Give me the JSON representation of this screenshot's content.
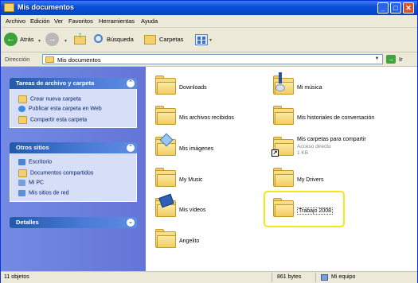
{
  "window": {
    "title": "Mis documentos"
  },
  "menu": [
    "Archivo",
    "Edición",
    "Ver",
    "Favoritos",
    "Herramientas",
    "Ayuda"
  ],
  "toolbar": {
    "back_label": "Atrás",
    "search_label": "Búsqueda",
    "folders_label": "Carpetas"
  },
  "address": {
    "label": "Dirección",
    "value": "Mis documentos",
    "go_label": "Ir"
  },
  "tasks": {
    "title": "Tareas de archivo y carpeta",
    "items": [
      "Crear nueva carpeta",
      "Publicar esta carpeta en Web",
      "Compartir esta carpeta"
    ]
  },
  "other_places": {
    "title": "Otros sitios",
    "items": [
      "Escritorio",
      "Documentos compartidos",
      "Mi PC",
      "Mis sitios de red"
    ]
  },
  "details": {
    "title": "Detalles"
  },
  "files": [
    {
      "name": "Downloads",
      "icon": "folder-icon"
    },
    {
      "name": "Mi música",
      "icon": "music-folder-icon"
    },
    {
      "name": "Mis archivos recibidos",
      "icon": "folder-icon"
    },
    {
      "name": "Mis historiales de conversación",
      "icon": "folder-icon"
    },
    {
      "name": "Mis imágenes",
      "icon": "pictures-folder-icon"
    },
    {
      "name": "Mis carpetas para compartir",
      "sub1": "Acceso directo",
      "sub2": "1 KB",
      "icon": "shortcut-icon"
    },
    {
      "name": "My Music",
      "icon": "folder-icon"
    },
    {
      "name": "My Drivers",
      "icon": "folder-icon"
    },
    {
      "name": "Mis vídeos",
      "icon": "videos-folder-icon"
    },
    {
      "name": "Trabajo 2008",
      "icon": "folder-icon",
      "highlighted": true
    },
    {
      "name": "Angelito",
      "icon": "folder-icon"
    }
  ],
  "status": {
    "count": "11 objetos",
    "size": "861 bytes",
    "location": "Mi equipo"
  },
  "colors": {
    "titlebar": "#0a4fd8",
    "taskpane": "#6375d6",
    "highlight": "#f4e71a"
  }
}
